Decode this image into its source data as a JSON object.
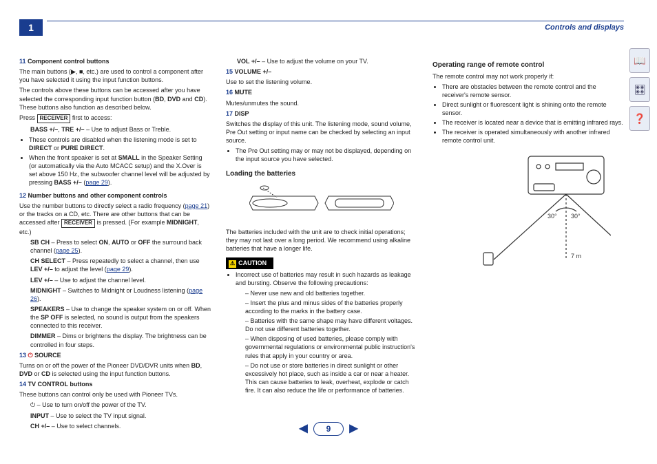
{
  "header": {
    "chapter": "1",
    "title": "Controls and displays"
  },
  "pager": {
    "prev": "◀",
    "page": "9",
    "next": "▶"
  },
  "left": {
    "i11": {
      "num": "11",
      "title": "Component control buttons",
      "p1a": "The main buttons (▶, ■, etc.) are used to control a component after you have selected it using the input function buttons.",
      "p2a": "The controls above these buttons can be accessed after you have selected the corresponding input function button (",
      "p2b": "BD",
      "p2c": ", ",
      "p2d": "DVD",
      "p2e": " and ",
      "p2f": "CD",
      "p2g": "). These buttons also function as described below.",
      "p3a": "Press ",
      "kbd": "RECEIVER",
      "p3b": " first to access:",
      "bass1": "BASS +/–",
      "bass2": ", ",
      "bass3": "TRE +/–",
      "bass4": " – Use to adjust Bass or Treble.",
      "bul1a": "These controls are disabled when the listening mode is set to ",
      "bul1b": "DIRECT",
      "bul1c": " or ",
      "bul1d": "PURE DIRECT",
      "bul1e": ".",
      "bul2a": "When the front speaker is set at ",
      "bul2b": "SMALL",
      "bul2c": " in the Speaker Setting (or automatically via the Auto MCACC setup) and the X.Over is set above 150 Hz, the subwoofer channel level will be adjusted by pressing ",
      "bul2d": "BASS +/–",
      "bul2e": " (",
      "bul2link": "page 29",
      "bul2f": ")."
    },
    "i12": {
      "num": "12",
      "title": "Number buttons and other component controls",
      "p1a": "Use the number buttons to directly select a radio frequency (",
      "p1link": "page 21",
      "p1b": ") or the tracks on a CD, etc. There are other buttons that can be accessed after ",
      "kbd": "RECEIVER",
      "p1c": " is pressed. (For example ",
      "p1d": "MIDNIGHT",
      "p1e": ", etc.)",
      "sb1": "SB CH",
      "sb2": " – Press to select ",
      "sb3": "ON",
      "sb4": ", ",
      "sb5": "AUTO",
      "sb6": " or ",
      "sb7": "OFF",
      "sb8": " the surround back channel (",
      "sblink": "page 25",
      "sb9": ").",
      "ch1": "CH SELECT",
      "ch2": " – Press repeatedly to select a channel, then use ",
      "ch3": "LEV +/–",
      "ch4": " to adjust the level (",
      "chlink": "page 29",
      "ch5": ").",
      "lev1": "LEV +/–",
      "lev2": " – Use to adjust the channel level.",
      "mid1": "MIDNIGHT",
      "mid2": " – Switches to Midnight or Loudness listening (",
      "midlink": "page 26",
      "mid3": ").",
      "sp1": "SPEAKERS",
      "sp2": " – Use to change the speaker system on or off. When the ",
      "sp3": "SP OFF",
      "sp4": " is selected, no sound is output from the speakers connected to this receiver.",
      "dim1": "DIMMER",
      "dim2": " – Dims or brightens the display. The brightness can be controlled in four steps."
    },
    "i13": {
      "num": "13",
      "icon": "⏻",
      "title": "SOURCE",
      "p1": "Turns on or off the power of the Pioneer DVD/DVR units when ",
      "p2": "BD",
      "p3": ", ",
      "p4": "DVD",
      "p5": " or ",
      "p6": "CD",
      "p7": " is selected using the input function buttons."
    },
    "i14": {
      "num": "14",
      "title": "TV CONTROL buttons",
      "p1": "These buttons can control only be used with Pioneer TVs.",
      "pw": "⏻ – Use to turn on/off the power of the TV.",
      "in1": "INPUT",
      "in2": " – Use to select the TV input signal.",
      "ch1": "CH +/–",
      "ch2": " – Use to select channels."
    }
  },
  "mid": {
    "vol1": "VOL +/–",
    "vol2": " – Use to adjust the volume on your TV.",
    "i15": {
      "num": "15",
      "title": "VOLUME +/–",
      "p1": "Use to set the listening volume."
    },
    "i16": {
      "num": "16",
      "title": "MUTE",
      "p1": "Mutes/unmutes the sound."
    },
    "i17": {
      "num": "17",
      "title": "DISP",
      "p1": "Switches the display of this unit. The listening mode, sound volume, Pre Out setting or input name can be checked by selecting an input source.",
      "bul1": "The Pre Out setting may or may not be displayed, depending on the input source you have selected."
    },
    "loading": {
      "title": "Loading the batteries",
      "p1": "The batteries included with the unit are to check initial operations; they may not last over a long period. We recommend using alkaline batteries that have a longer life."
    },
    "caution": {
      "label": "CAUTION",
      "b1": "Incorrect use of batteries may result in such hazards as leakage and bursting. Observe the following precautions:",
      "d1": "Never use new and old batteries together.",
      "d2": "Insert the plus and minus sides of the batteries properly according to the marks in the battery case.",
      "d3": "Batteries with the same shape may have different voltages. Do not use different batteries together.",
      "d4": "When disposing of used batteries, please comply with governmental regulations or environmental public instruction's rules that apply in your country or area.",
      "d5": "Do not use or store batteries in direct sunlight or other excessively hot place, such as inside a car or near a heater. This can cause batteries to leak, overheat, explode or catch fire. It can also reduce the life or performance of batteries."
    }
  },
  "right": {
    "range": {
      "title": "Operating range of remote control",
      "p1": "The remote control may not work properly if:",
      "b1": "There are obstacles between the remote control and the receiver's remote sensor.",
      "b2": "Direct sunlight or fluorescent light is shining onto the remote sensor.",
      "b3": "The receiver is located near a device that is emitting infrared rays.",
      "b4": "The receiver is operated simultaneously with another infrared remote control unit.",
      "angle": "30°",
      "dist": "7 m"
    }
  },
  "tabs": {
    "t1": "📖",
    "t2": "🎛",
    "t3": "❓"
  }
}
